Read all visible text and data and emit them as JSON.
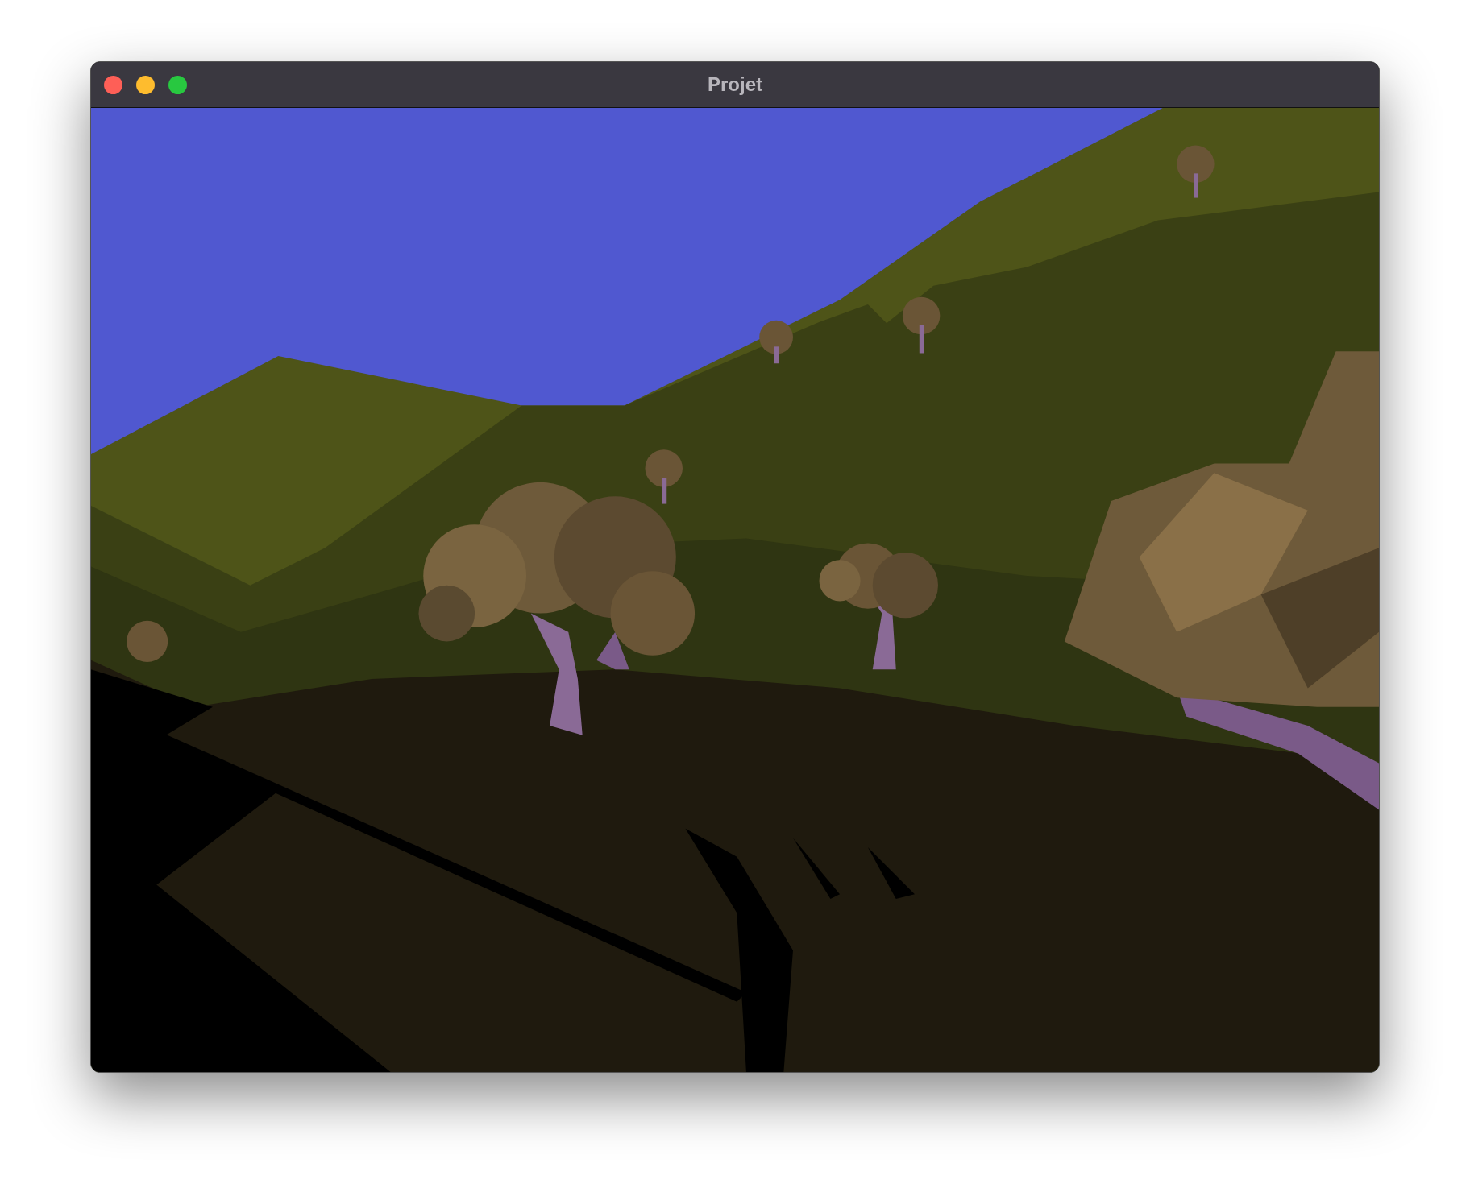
{
  "window": {
    "title": "Projet"
  }
}
